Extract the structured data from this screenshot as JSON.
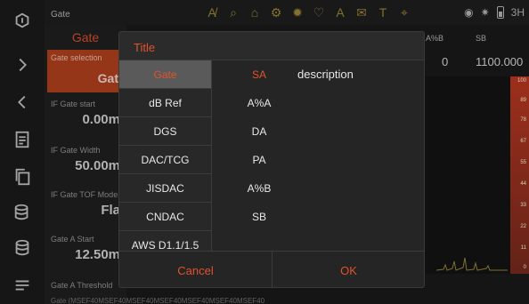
{
  "topbar": {
    "title": "Gate",
    "tool_icons": [
      "A̸",
      "⌕",
      "⌂",
      "⚙",
      "✹",
      "♡",
      "A",
      "✉",
      "T",
      "⌖"
    ],
    "status_icons": [
      "◉",
      "✷"
    ],
    "time": "3H"
  },
  "left_panel": {
    "header": "Gate",
    "selected": {
      "label": "Gate selection",
      "value": "Gat"
    },
    "items": [
      {
        "label": "IF Gate start",
        "value": "0.00m"
      },
      {
        "label": "IF Gate Width",
        "value": "50.00m"
      },
      {
        "label": "IF Gate TOF Mode",
        "value": "Fla"
      },
      {
        "label": "Gate A Start",
        "value": "12.50m"
      },
      {
        "label": "Gate A Threshold",
        "value": ""
      }
    ],
    "bottom_text": "Gate (MSEF40MSEF40MSEF40MSEF40MSEF40MSEF40MSEF40"
  },
  "measurements": {
    "headers": [
      "A%B",
      "SB"
    ],
    "values": [
      "0",
      "1100.000"
    ]
  },
  "scale_ticks": [
    "100",
    "89",
    "78",
    "67",
    "55",
    "44",
    "33",
    "22",
    "11",
    "0"
  ],
  "dialog": {
    "title": "Title",
    "tabs": [
      "Gate",
      "dB Ref",
      "DGS",
      "DAC/TCG",
      "JISDAC",
      "CNDAC",
      "AWS D1.1/1.5"
    ],
    "active_tab": "Gate",
    "options": [
      "SA",
      "A%A",
      "DA",
      "PA",
      "A%B",
      "SB"
    ],
    "selected_option": "SA",
    "description": "description",
    "cancel_label": "Cancel",
    "ok_label": "OK"
  },
  "colors": {
    "accent": "#e0522b",
    "background": "#1a1a1a",
    "dialog": "#252525",
    "active_tab": "#5a5a5a"
  }
}
